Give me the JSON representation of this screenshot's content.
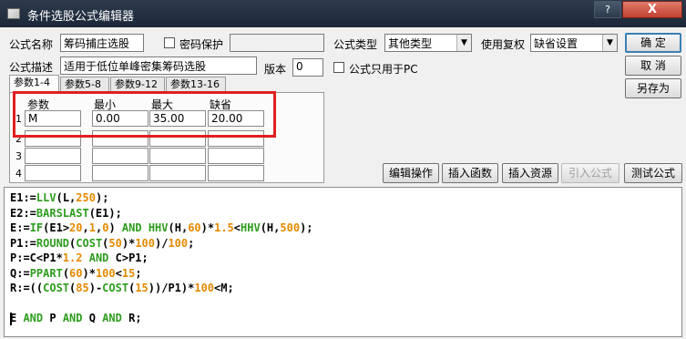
{
  "window": {
    "title": "条件选股公式编辑器",
    "help_button": "?",
    "close_button": "X"
  },
  "form": {
    "name_label": "公式名称",
    "name_value": "筹码捕庄选股",
    "password_label": "密码保护",
    "password_checked": false,
    "password_value": "",
    "type_label": "公式类型",
    "type_value": "其他类型",
    "rights_label": "使用复权",
    "rights_value": "缺省设置",
    "desc_label": "公式描述",
    "desc_value": "适用于低位单峰密集筹码选股",
    "version_label": "版本",
    "version_value": "0",
    "pc_only_label": "公式只用于PC",
    "pc_only_checked": false
  },
  "buttons": {
    "ok": "确  定",
    "cancel": "取  消",
    "save_as": "另存为",
    "edit_ops": "编辑操作",
    "insert_func": "插入函数",
    "insert_resource": "插入资源",
    "import_formula": "引入公式",
    "test_formula": "测试公式"
  },
  "param_tabs": [
    {
      "label": "参数1-4",
      "active": true
    },
    {
      "label": "参数5-8",
      "active": false
    },
    {
      "label": "参数9-12",
      "active": false
    },
    {
      "label": "参数13-16",
      "active": false
    }
  ],
  "param_table": {
    "headers": [
      "参数",
      "最小",
      "最大",
      "缺省"
    ],
    "rows": [
      {
        "num": "1",
        "name": "M",
        "min": "0.00",
        "max": "35.00",
        "default": "20.00"
      },
      {
        "num": "2",
        "name": "",
        "min": "",
        "max": "",
        "default": ""
      },
      {
        "num": "3",
        "name": "",
        "min": "",
        "max": "",
        "default": ""
      },
      {
        "num": "4",
        "name": "",
        "min": "",
        "max": "",
        "default": ""
      }
    ]
  },
  "code": [
    [
      [
        "id",
        "E1:="
      ],
      [
        "fn",
        "LLV"
      ],
      [
        "id",
        "(L,"
      ],
      [
        "num",
        "250"
      ],
      [
        "id",
        ");"
      ]
    ],
    [
      [
        "id",
        "E2:="
      ],
      [
        "fn",
        "BARSLAST"
      ],
      [
        "id",
        "(E1);"
      ]
    ],
    [
      [
        "id",
        "E:="
      ],
      [
        "fn",
        "IF"
      ],
      [
        "id",
        "(E1>"
      ],
      [
        "num",
        "20"
      ],
      [
        "id",
        ","
      ],
      [
        "num",
        "1"
      ],
      [
        "id",
        ","
      ],
      [
        "num",
        "0"
      ],
      [
        "id",
        ") "
      ],
      [
        "fn",
        "AND"
      ],
      [
        "id",
        " "
      ],
      [
        "fn",
        "HHV"
      ],
      [
        "id",
        "(H,"
      ],
      [
        "num",
        "60"
      ],
      [
        "id",
        ")*"
      ],
      [
        "num",
        "1.5"
      ],
      [
        "id",
        "<"
      ],
      [
        "fn",
        "HHV"
      ],
      [
        "id",
        "(H,"
      ],
      [
        "num",
        "500"
      ],
      [
        "id",
        ");"
      ]
    ],
    [
      [
        "id",
        "P1:="
      ],
      [
        "fn",
        "ROUND"
      ],
      [
        "id",
        "("
      ],
      [
        "fn",
        "COST"
      ],
      [
        "id",
        "("
      ],
      [
        "num",
        "50"
      ],
      [
        "id",
        ")*"
      ],
      [
        "num",
        "100"
      ],
      [
        "id",
        ")/"
      ],
      [
        "num",
        "100"
      ],
      [
        "id",
        ";"
      ]
    ],
    [
      [
        "id",
        "P:=C<P1*"
      ],
      [
        "num",
        "1.2"
      ],
      [
        "id",
        " "
      ],
      [
        "fn",
        "AND"
      ],
      [
        "id",
        " C>P1;"
      ]
    ],
    [
      [
        "id",
        "Q:="
      ],
      [
        "fn",
        "PPART"
      ],
      [
        "id",
        "("
      ],
      [
        "num",
        "60"
      ],
      [
        "id",
        ")*"
      ],
      [
        "num",
        "100"
      ],
      [
        "id",
        "<"
      ],
      [
        "num",
        "15"
      ],
      [
        "id",
        ";"
      ]
    ],
    [
      [
        "id",
        "R:=(("
      ],
      [
        "fn",
        "COST"
      ],
      [
        "id",
        "("
      ],
      [
        "num",
        "85"
      ],
      [
        "id",
        ")-"
      ],
      [
        "fn",
        "COST"
      ],
      [
        "id",
        "("
      ],
      [
        "num",
        "15"
      ],
      [
        "id",
        "))/P1)*"
      ],
      [
        "num",
        "100"
      ],
      [
        "id",
        "<M;"
      ]
    ],
    [],
    [
      [
        "id",
        "E "
      ],
      [
        "fn",
        "AND"
      ],
      [
        "id",
        " P "
      ],
      [
        "fn",
        "AND"
      ],
      [
        "id",
        " Q "
      ],
      [
        "fn",
        "AND"
      ],
      [
        "id",
        " R;"
      ]
    ]
  ]
}
